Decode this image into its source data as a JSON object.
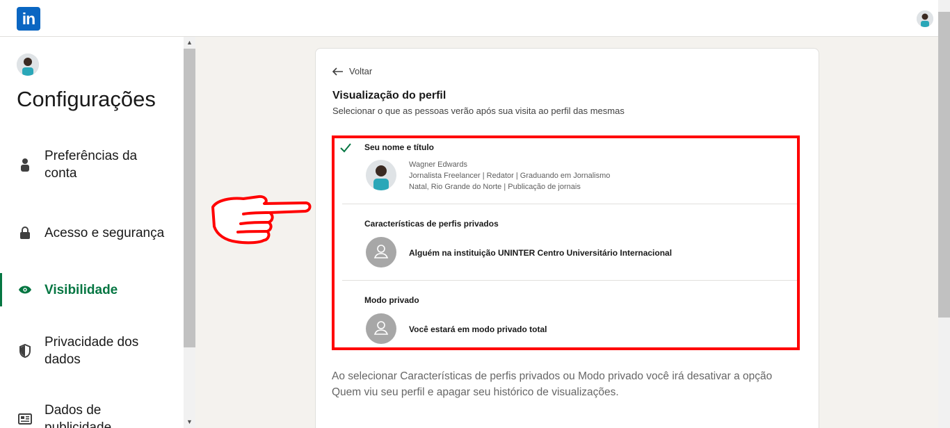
{
  "header": {
    "logo_text": "in",
    "brand_color": "#0a66c2"
  },
  "sidebar": {
    "title": "Configurações",
    "items": [
      {
        "label": "Preferências da conta",
        "icon": "person-icon"
      },
      {
        "label": "Acesso e segurança",
        "icon": "lock-icon"
      },
      {
        "label": "Visibilidade",
        "icon": "eye-icon",
        "active": true
      },
      {
        "label": "Privacidade dos dados",
        "icon": "shield-icon"
      },
      {
        "label": "Dados de publicidade",
        "icon": "newspaper-icon"
      }
    ],
    "active_color": "#057642"
  },
  "page": {
    "back_label": "Voltar",
    "title": "Visualização do perfil",
    "subtitle": "Selecionar o que as pessoas verão após sua visita ao perfil das mesmas",
    "options": [
      {
        "title": "Seu nome e título",
        "selected": true,
        "name": "Wagner Edwards",
        "headline": "Jornalista Freelancer | Redator | Graduando em Jornalismo",
        "location": "Natal, Rio Grande do Norte | Publicação de jornais"
      },
      {
        "title": "Características de perfis privados",
        "selected": false,
        "text": "Alguém na instituição UNINTER Centro Universitário Internacional"
      },
      {
        "title": "Modo privado",
        "selected": false,
        "text": "Você estará em modo privado total"
      }
    ],
    "note": "Ao selecionar Características de perfis privados ou Modo privado você irá desativar a opção Quem viu seu perfil e apagar seu histórico de visualizações."
  },
  "annotation": {
    "highlight_color": "#ff0000",
    "pointer": "pointing-hand-icon"
  }
}
